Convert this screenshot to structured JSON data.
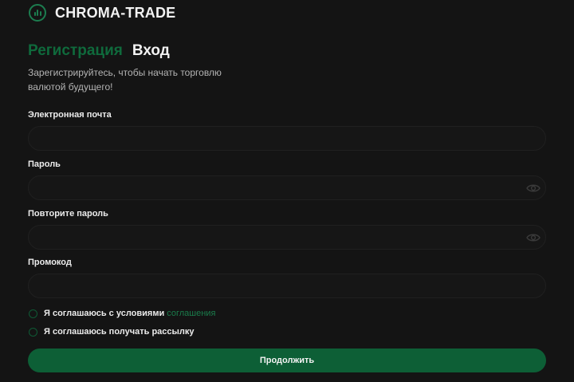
{
  "header": {
    "logo_icon": "chart-bars-icon",
    "brand": "CHROMA-TRADE"
  },
  "tabs": [
    {
      "label": "Регистрация",
      "active": true
    },
    {
      "label": "Вход",
      "active": false
    }
  ],
  "subtitle": "Зарегистрируйтесь, чтобы начать торговлю валютой будущего!",
  "form": {
    "email_label": "Электронная почта",
    "email_value": "",
    "password_label": "Пароль",
    "password_value": "",
    "repeat_password_label": "Повторите пароль",
    "repeat_password_value": "",
    "promo_label": "Промокод",
    "promo_value": "",
    "eye_icon": "eye-icon"
  },
  "agreements": {
    "terms_text": "Я соглашаюсь с условиями",
    "terms_link": "соглашения",
    "newsletter_text": "Я соглашаюсь получать рассылку"
  },
  "submit_label": "Продолжить",
  "colors": {
    "background": "#141414",
    "accent": "#0f6a3c",
    "button": "#0d5f36",
    "link": "#1a7c4b"
  }
}
